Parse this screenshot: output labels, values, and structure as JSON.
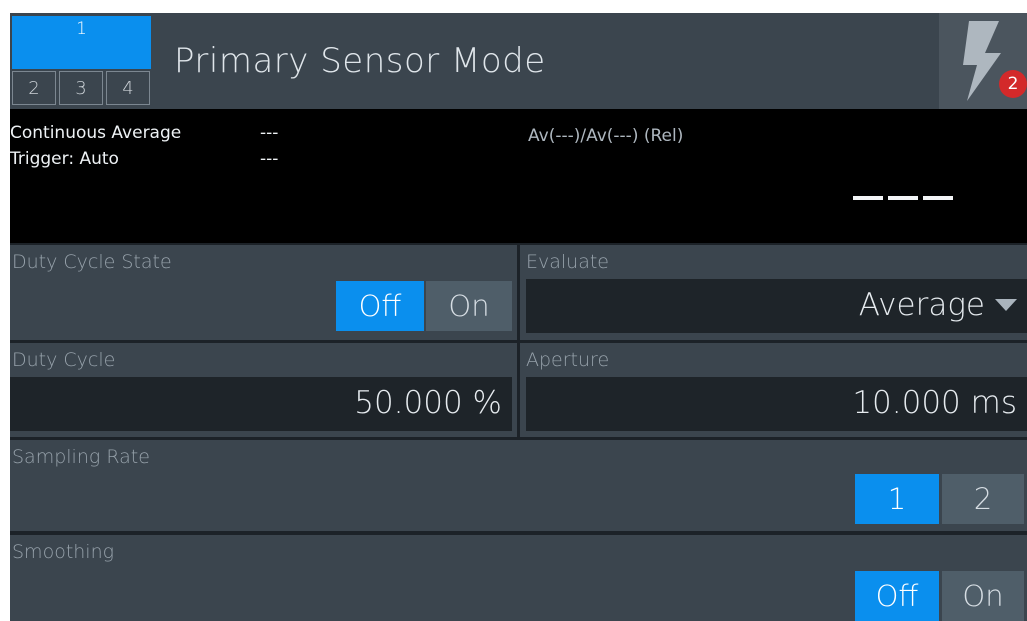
{
  "header": {
    "title": "Primary Sensor Mode",
    "measurements": [
      "1",
      "2",
      "3",
      "4"
    ],
    "alert_count": "2"
  },
  "readout": {
    "line1_label": "Continuous Average",
    "line1_value": "---",
    "line2_label": "Trigger: Auto",
    "line2_value": "---",
    "relative_label": "Av(---)/Av(---) (Rel)"
  },
  "duty_cycle_state": {
    "label": "Duty Cycle State",
    "options": [
      "Off",
      "On"
    ],
    "selected": "Off"
  },
  "evaluate": {
    "label": "Evaluate",
    "value": "Average"
  },
  "duty_cycle": {
    "label": "Duty Cycle",
    "value": "50.000 %"
  },
  "aperture": {
    "label": "Aperture",
    "value": "10.000 ms"
  },
  "sampling_rate": {
    "label": "Sampling Rate",
    "options": [
      "1",
      "2"
    ],
    "selected": "1"
  },
  "smoothing": {
    "label": "Smoothing",
    "options": [
      "Off",
      "On"
    ],
    "selected": "Off"
  },
  "colors": {
    "accent": "#0a8fee",
    "panel": "#3b454e",
    "alert": "#d3292a"
  }
}
